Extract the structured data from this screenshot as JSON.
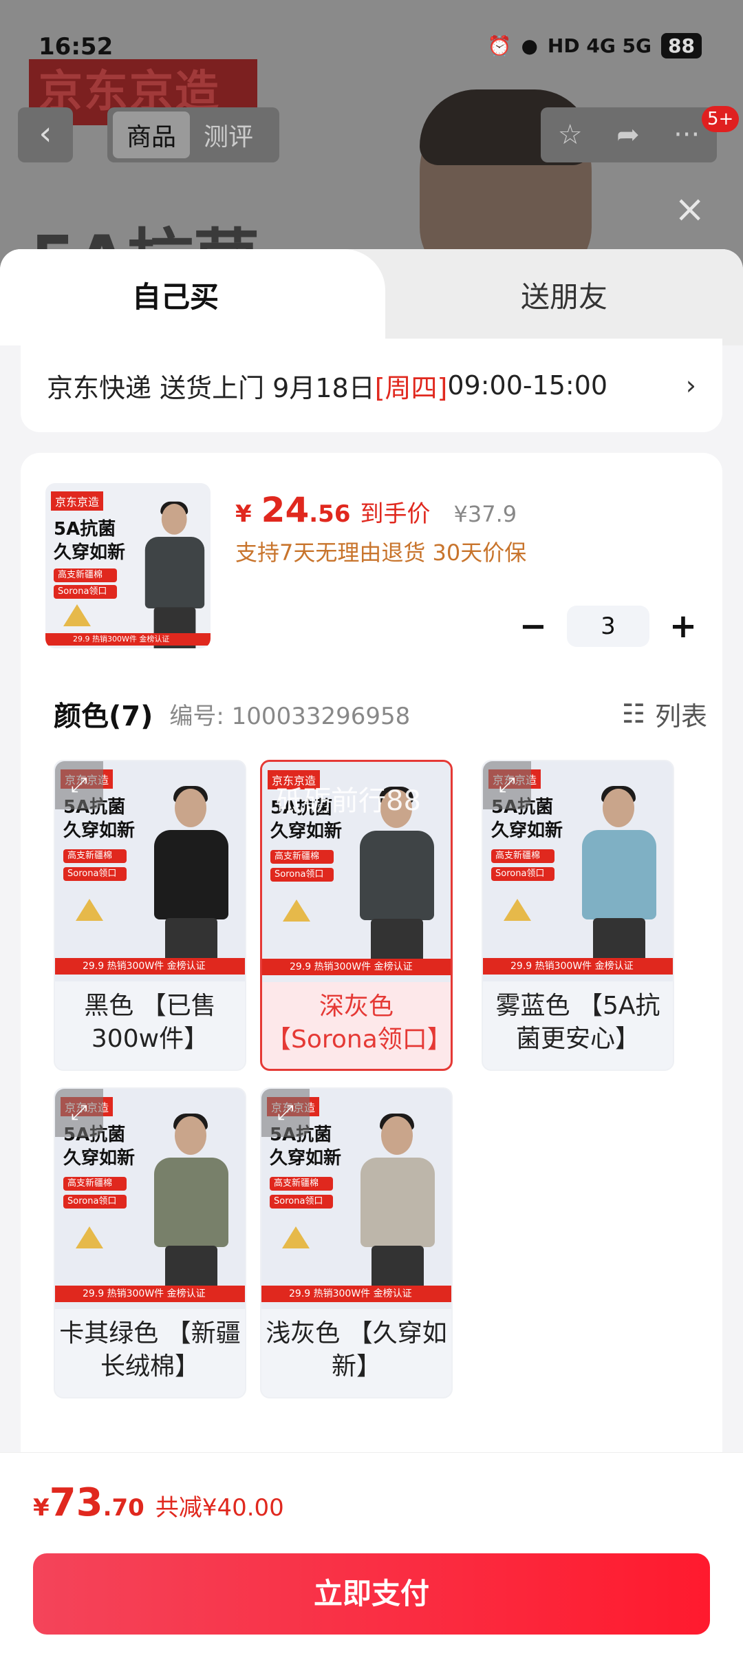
{
  "status_bar": {
    "time": "16:52",
    "network": "HD 4G 5G",
    "battery": "88"
  },
  "background_page": {
    "brand": "京东京造",
    "big_text": "5A抗菌",
    "tabs": [
      "商品",
      "测评"
    ],
    "notif_badge": "5+"
  },
  "tabs": {
    "self": "自己买",
    "gift": "送朋友"
  },
  "delivery": {
    "prefix": "京东快递 送货上门 9月18日 ",
    "weekday": "[周四]",
    "time": " 09:00-15:00",
    "chevron": "›"
  },
  "product": {
    "price_currency": "¥",
    "price_int": "24",
    "price_dec": ".56",
    "price_label": "到手价",
    "orig_price": "¥37.9",
    "policy": "支持7天无理由退货  30天价保",
    "quantity": "3",
    "minus": "−",
    "plus": "+"
  },
  "color_section": {
    "title": "颜色(7)",
    "code": "编号: 100033296958",
    "list_label": "列表"
  },
  "thumb": {
    "tag": "京东京造",
    "headline1": "5A抗菌",
    "headline2": "久穿如新",
    "chip1": "高支新疆棉",
    "chip2": "Sorona领口",
    "band": "29.9  热销300W件 金榜认证"
  },
  "colors": [
    {
      "label": "黑色 【已售300w件】",
      "shirt": "#1c1c1c",
      "selected": false
    },
    {
      "label": "深灰色 【Sorona领口】",
      "shirt": "#3f4446",
      "selected": true,
      "watermark": "砥砺前行88"
    },
    {
      "label": "雾蓝色 【5A抗菌更安心】",
      "shirt": "#7fb0c4",
      "selected": false
    },
    {
      "label": "卡其绿色 【新疆长绒棉】",
      "shirt": "#78806a",
      "selected": false
    },
    {
      "label": "浅灰色 【久穿如新】",
      "shirt": "#bdb6aa",
      "selected": false
    }
  ],
  "footer": {
    "currency": "¥",
    "total_int": "73",
    "total_dec": ".70",
    "saving": "共减¥40.00",
    "pay_button": "立即支付"
  },
  "close_icon": "×"
}
